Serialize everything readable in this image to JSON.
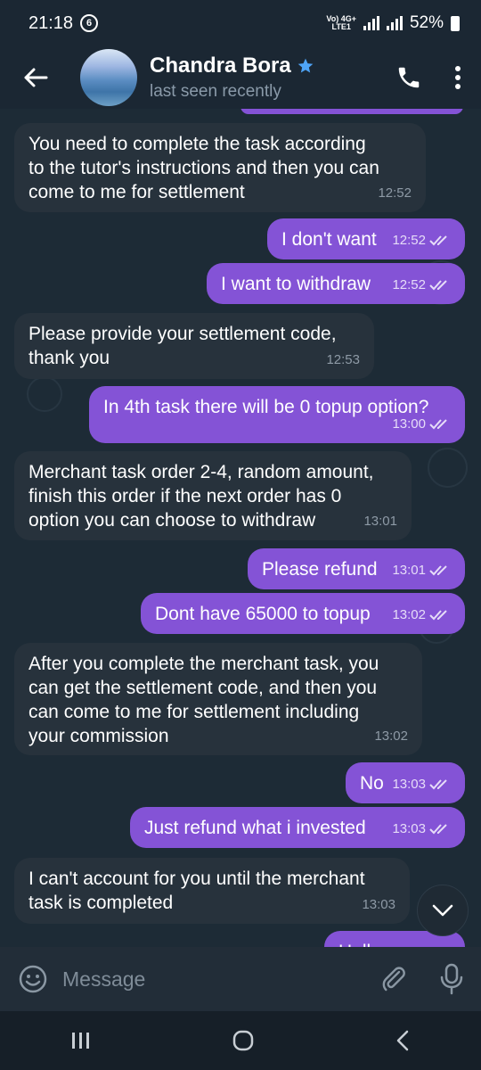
{
  "status_bar": {
    "time": "21:18",
    "indicator": "6",
    "net_top": "Vo) 4G+",
    "net_bottom": "LTE1",
    "battery": "52%"
  },
  "header": {
    "contact_name": "Chandra Bora",
    "contact_status": "last seen recently"
  },
  "messages": [
    {
      "direction": "in",
      "text": "You need to complete the task according\nto the tutor's instructions and then you can\ncome to me for settlement",
      "time": "12:52"
    },
    {
      "direction": "out",
      "text": "I don't want",
      "time": "12:52"
    },
    {
      "direction": "out",
      "text": "I want to withdraw",
      "time": "12:52"
    },
    {
      "direction": "in",
      "text": "Please provide your settlement code,\nthank you",
      "time": "12:53"
    },
    {
      "direction": "out",
      "text": "In 4th task there will be 0 topup option?",
      "time": "13:00"
    },
    {
      "direction": "in",
      "text": "Merchant task order 2-4, random amount,\nfinish this order if the next order has 0\noption you can choose to withdraw",
      "time": "13:01"
    },
    {
      "direction": "out",
      "text": "Please refund",
      "time": "13:01"
    },
    {
      "direction": "out",
      "text": "Dont have 65000 to topup",
      "time": "13:02"
    },
    {
      "direction": "in",
      "text": "After you complete the merchant task, you\ncan get the settlement code, and then you\ncan come to me for settlement including\nyour commission",
      "time": "13:02"
    },
    {
      "direction": "out",
      "text": "No",
      "time": "13:03"
    },
    {
      "direction": "out",
      "text": "Just refund what i invested",
      "time": "13:03"
    },
    {
      "direction": "in",
      "text": "I can't account for you until the merchant\ntask is completed",
      "time": "13:03"
    },
    {
      "direction": "out",
      "text": "Hello",
      "time": ""
    }
  ],
  "composer": {
    "placeholder": "Message"
  },
  "colors": {
    "outgoing": "#8453d6",
    "incoming": "#27323c",
    "background": "#1d2b36",
    "star": "#4ea4f6"
  }
}
